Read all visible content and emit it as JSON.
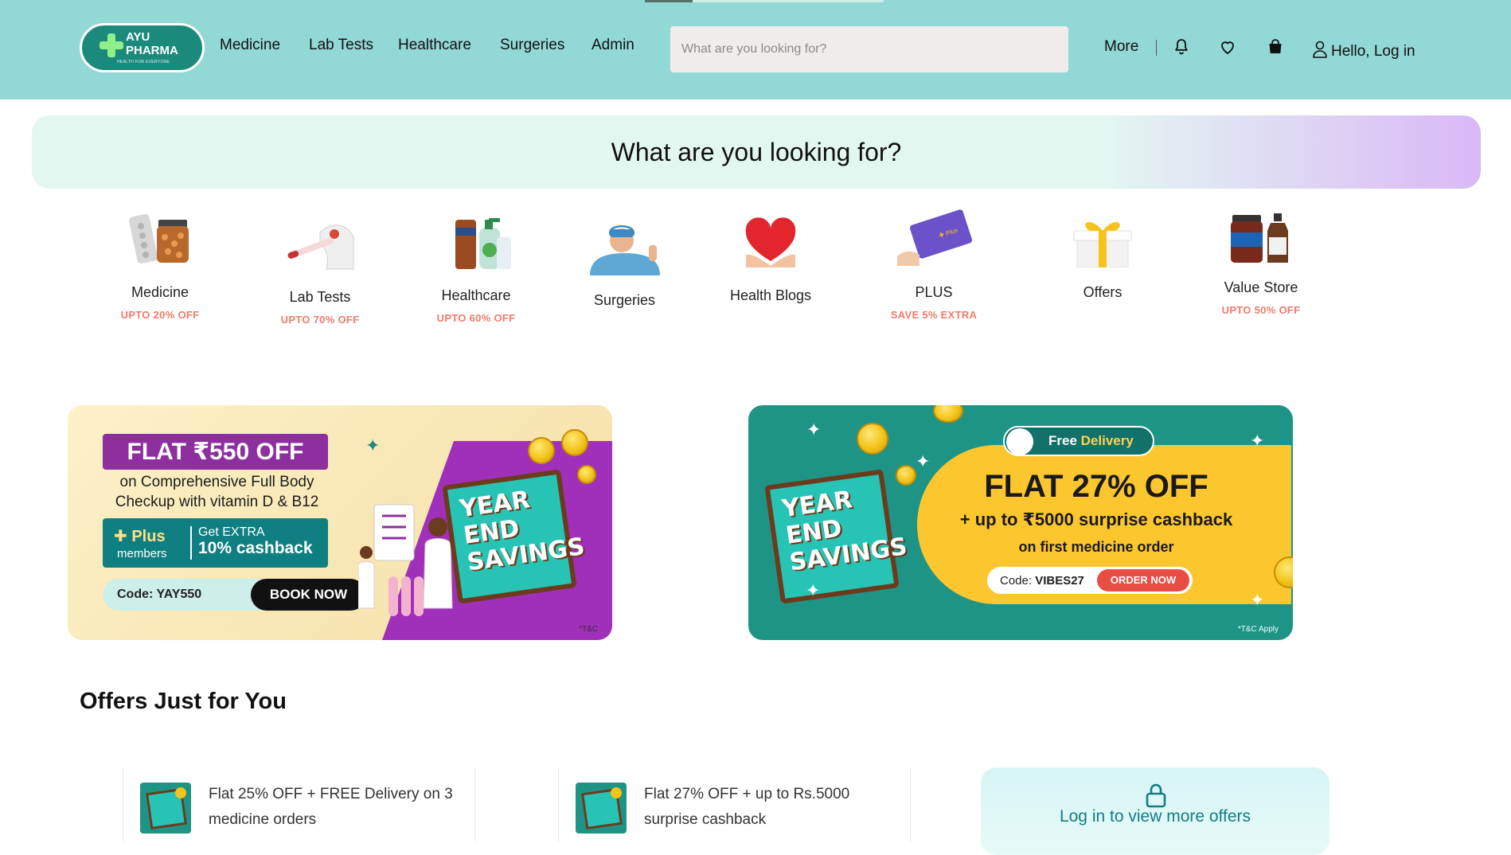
{
  "brand": {
    "name_line1": "AYU",
    "name_line2": "PHARMA",
    "tagline": "HEALTH FOR EVERYONE",
    "colors": {
      "header_bg": "#92d8d4",
      "logo_bg": "#1b8a7c",
      "accent": "#157b86",
      "offer_red": "#ef7b6b"
    }
  },
  "header": {
    "nav": [
      "Medicine",
      "Lab Tests",
      "Healthcare",
      "Surgeries",
      "Admin"
    ],
    "search_placeholder": "What are you looking for?",
    "more_label": "More",
    "icons": [
      "bell-icon",
      "heart-icon",
      "bag-icon",
      "user-icon"
    ],
    "login_label": "Hello, Log in"
  },
  "hero": {
    "title": "What are you looking for?"
  },
  "categories": [
    {
      "label": "Medicine",
      "offer": "UPTO 20% OFF",
      "icon": "medicine-icon"
    },
    {
      "label": "Lab Tests",
      "offer": "UPTO 70% OFF",
      "icon": "test-tube-icon"
    },
    {
      "label": "Healthcare",
      "offer": "UPTO 60% OFF",
      "icon": "healthcare-products-icon"
    },
    {
      "label": "Surgeries",
      "offer": "",
      "icon": "surgeon-icon"
    },
    {
      "label": "Health Blogs",
      "offer": "",
      "icon": "heart-hands-icon"
    },
    {
      "label": "PLUS",
      "offer": "SAVE 5% EXTRA",
      "icon": "plus-card-icon"
    },
    {
      "label": "Offers",
      "offer": "",
      "icon": "gift-icon"
    },
    {
      "label": "Value Store",
      "offer": "UPTO 50% OFF",
      "icon": "value-store-icon"
    }
  ],
  "banners": {
    "left": {
      "headline": "FLAT ₹550 OFF",
      "sub": "on Comprehensive Full Body Checkup with vitamin D & B12",
      "plus_label": "Plus",
      "plus_members": "members",
      "plus_extra": "Get EXTRA",
      "plus_cashback": "10% cashback",
      "code": "Code: YAY550",
      "cta": "BOOK NOW",
      "badge": "YEAR END SAVINGS",
      "tnc": "*T&C"
    },
    "right": {
      "free_delivery_1": "Free",
      "free_delivery_2": "Delivery",
      "headline": "FLAT 27% OFF",
      "sub": "+ up to ₹5000 surprise cashback",
      "sub2": "on first medicine order",
      "code_label": "Code:",
      "code_value": "VIBES27",
      "cta": "ORDER NOW",
      "badge": "YEAR END SAVINGS",
      "tnc": "*T&C Apply"
    }
  },
  "offers": {
    "title": "Offers Just for You",
    "items": [
      {
        "text": "Flat 25% OFF + FREE Delivery on 3 medicine orders"
      },
      {
        "text": "Flat 27% OFF + up to Rs.5000 surprise cashback"
      }
    ],
    "login_card": "Log in to view more offers"
  }
}
